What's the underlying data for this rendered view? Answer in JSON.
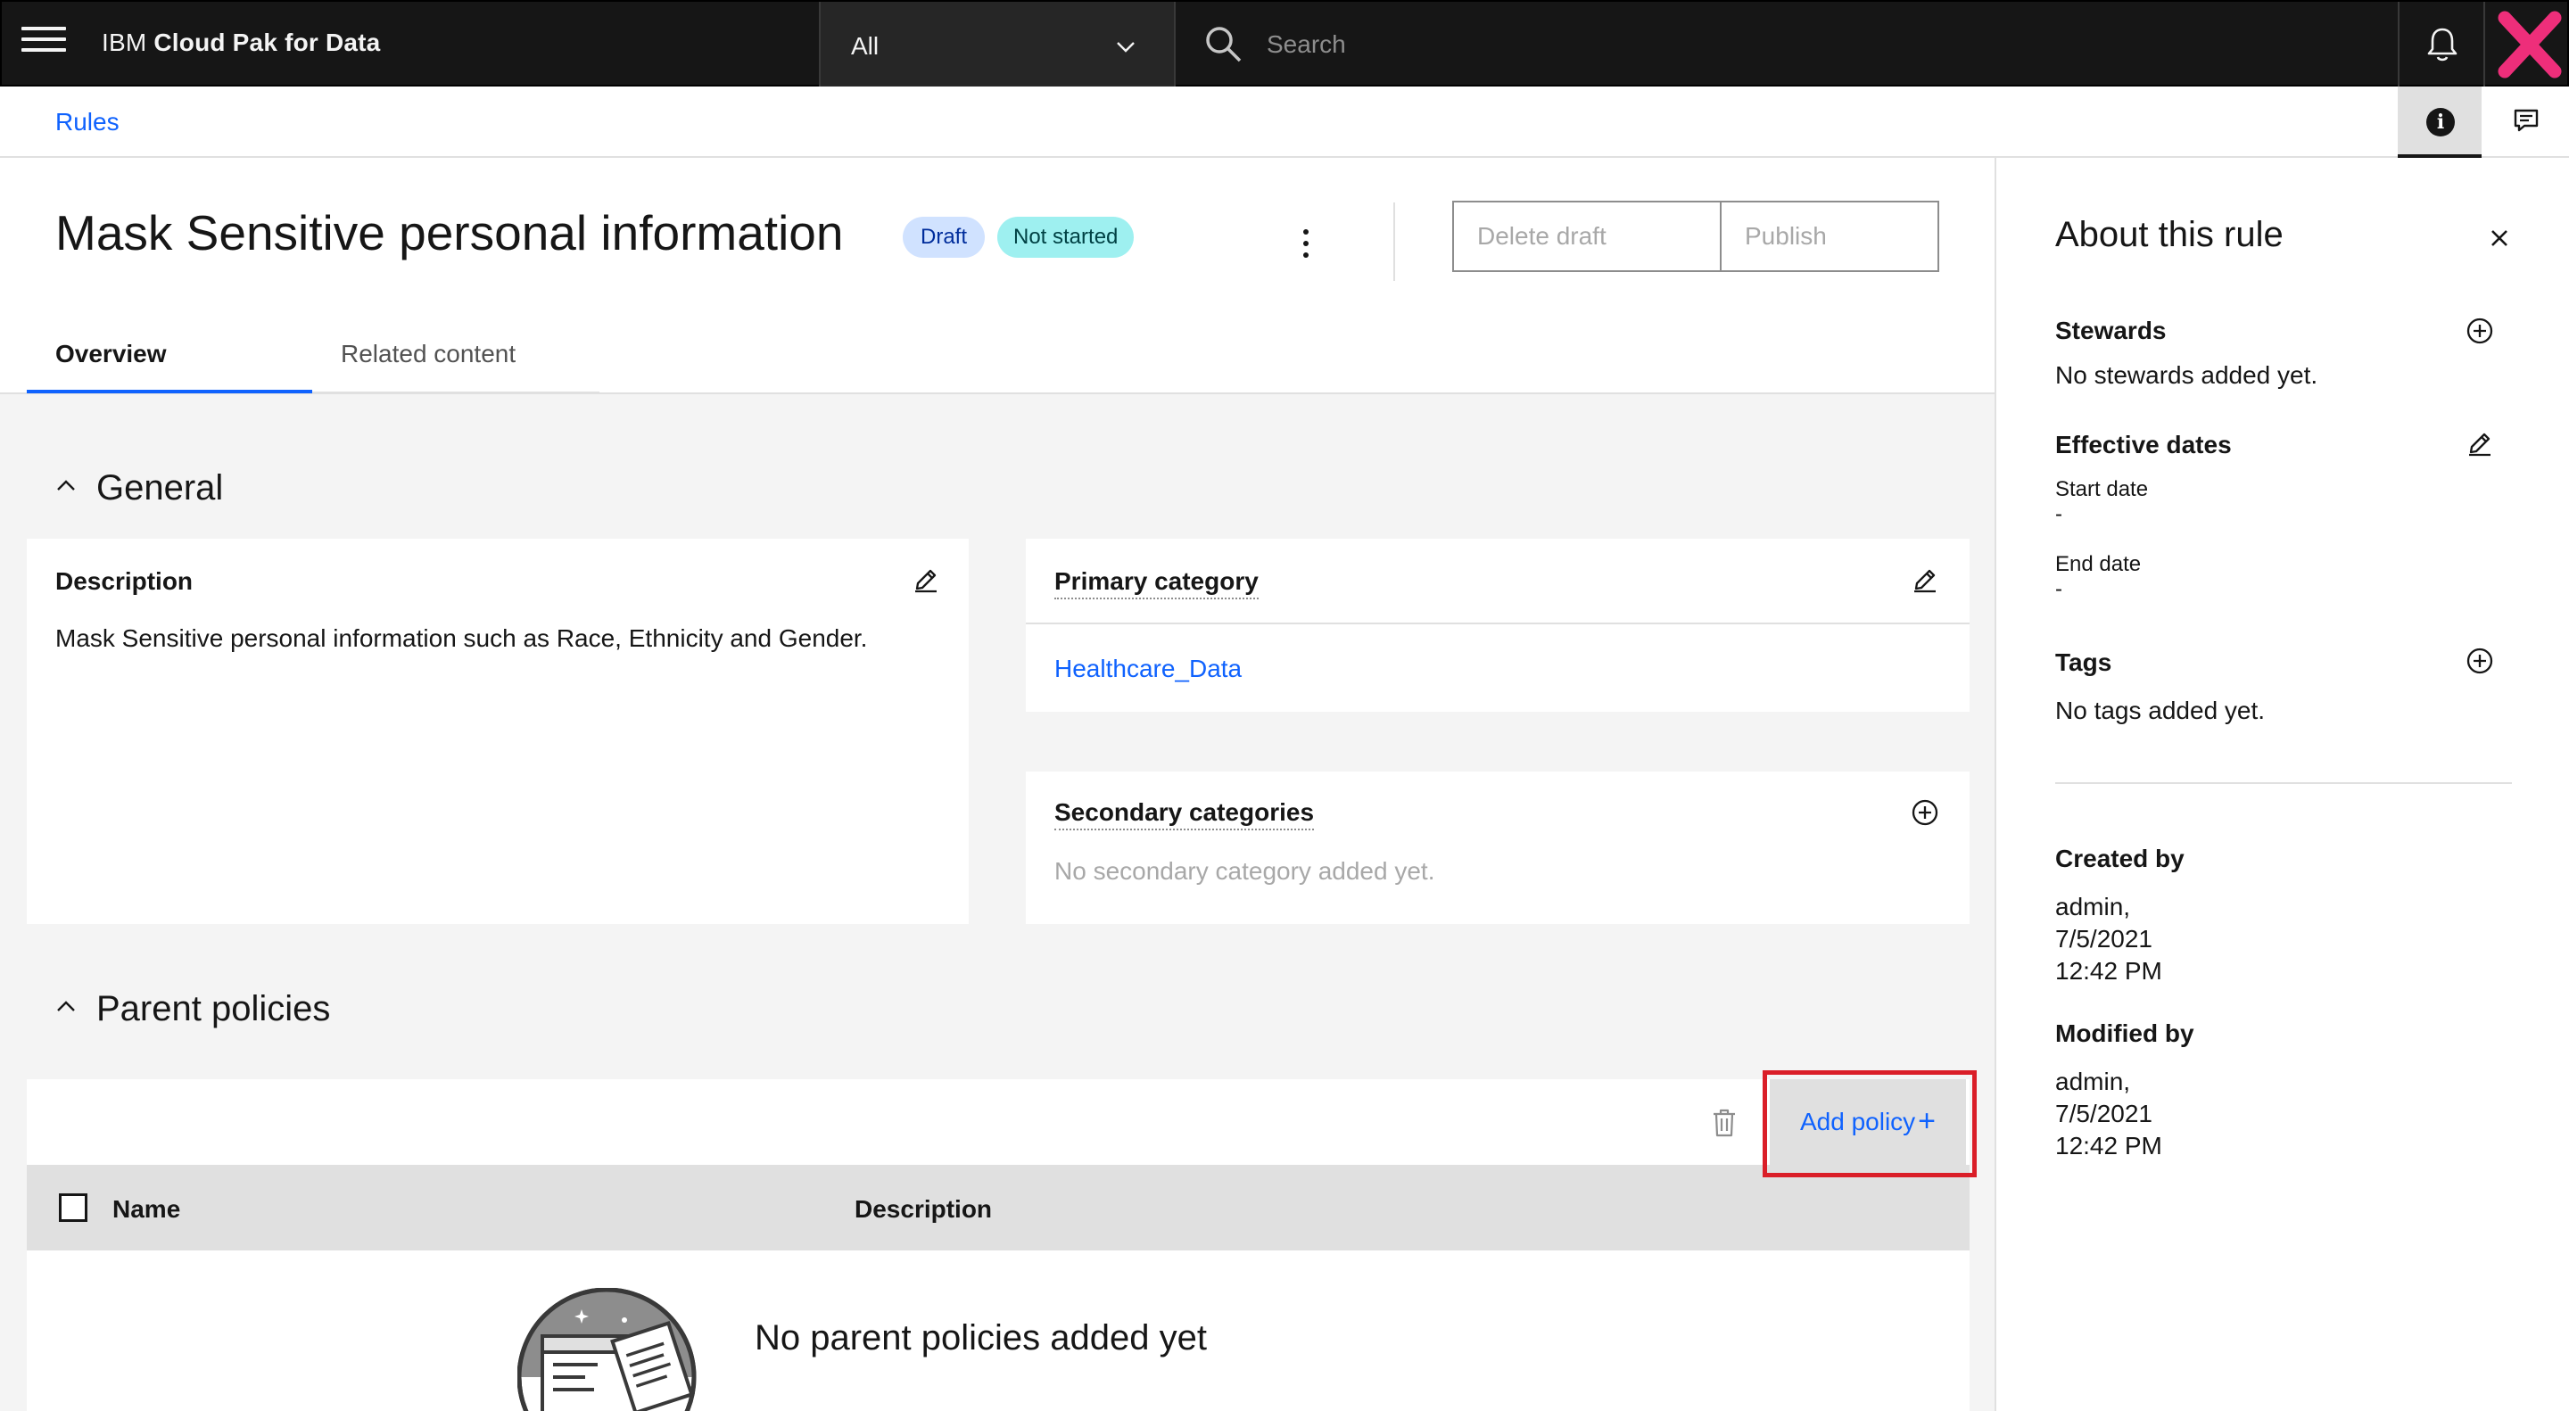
{
  "topbar": {
    "brand_prefix": "IBM",
    "brand_product": "Cloud Pak for Data",
    "scope_value": "All",
    "search_placeholder": "Search"
  },
  "breadcrumb": {
    "label": "Rules"
  },
  "rule": {
    "title": "Mask Sensitive personal information",
    "badge_draft": "Draft",
    "badge_status": "Not started",
    "delete_draft_label": "Delete draft",
    "publish_label": "Publish"
  },
  "tabs": [
    {
      "label": "Overview",
      "active": true
    },
    {
      "label": "Related content",
      "active": false
    }
  ],
  "general": {
    "heading": "General",
    "description_title": "Description",
    "description_text": "Mask Sensitive personal information such as Race, Ethnicity and Gender.",
    "primary_category_title": "Primary category",
    "primary_category_value": "Healthcare_Data",
    "secondary_categories_title": "Secondary categories",
    "secondary_categories_empty": "No secondary category added yet."
  },
  "parent_policies": {
    "heading": "Parent policies",
    "add_policy_label": "Add policy",
    "add_policy_symbol": "+",
    "columns": [
      "Name",
      "Description"
    ],
    "empty_text": "No parent policies added yet"
  },
  "side_panel": {
    "title": "About this rule",
    "stewards_label": "Stewards",
    "stewards_empty": "No stewards added yet.",
    "effective_dates_label": "Effective dates",
    "start_date_label": "Start date",
    "start_date_value": "-",
    "end_date_label": "End date",
    "end_date_value": "-",
    "tags_label": "Tags",
    "tags_empty": "No tags added yet.",
    "created_by_label": "Created by",
    "created_by_user": "admin,",
    "created_by_date": "7/5/2021",
    "created_by_time": "12:42 PM",
    "modified_by_label": "Modified by",
    "modified_by_user": "admin,",
    "modified_by_date": "7/5/2021",
    "modified_by_time": "12:42 PM"
  },
  "colors": {
    "accent": "#0f62fe",
    "topbar": "#161616",
    "highlight": "#da1e28",
    "badge_draft_bg": "#d0e2ff",
    "badge_status_bg": "#9ef0f0"
  },
  "icons": [
    "menu-icon",
    "chevron-down-icon",
    "search-icon",
    "notification-icon",
    "close-icon",
    "info-icon",
    "chat-icon",
    "overflow-menu-icon",
    "chevron-up-icon",
    "edit-icon",
    "add-circle-icon",
    "trash-icon",
    "add-icon",
    "empty-state-illustration"
  ]
}
